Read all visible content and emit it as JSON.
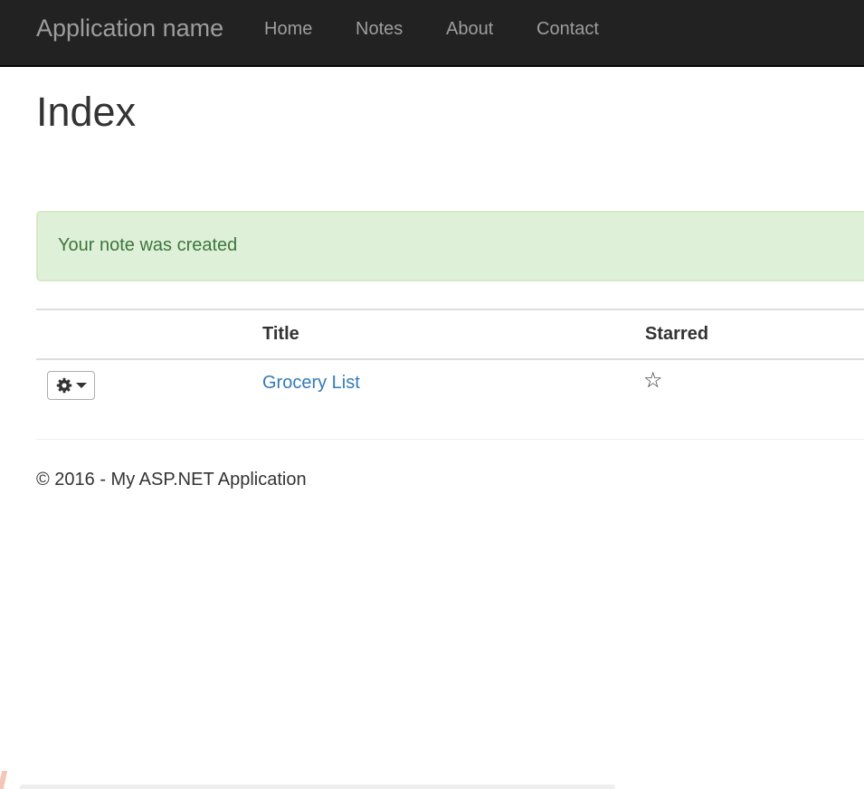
{
  "navbar": {
    "brand": "Application name",
    "links": [
      "Home",
      "Notes",
      "About",
      "Contact"
    ]
  },
  "page": {
    "title": "Index"
  },
  "alert": {
    "message": "Your note was created",
    "color": "#3c763d",
    "background": "#dff0d8"
  },
  "table": {
    "headers": [
      "",
      "Title",
      "Starred"
    ],
    "rows": [
      {
        "actions_icon": "gear-icon",
        "title": "Grocery List",
        "starred_glyph": "☆",
        "starred": false
      }
    ]
  },
  "footer": {
    "text": "© 2016 - My ASP.NET Application"
  },
  "colors": {
    "navbar": "#222222",
    "link": "#337ab7"
  }
}
